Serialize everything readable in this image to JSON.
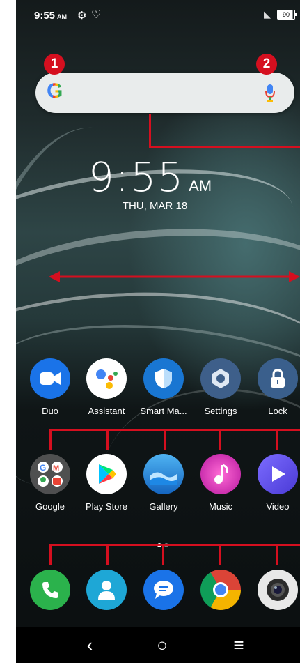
{
  "status_bar": {
    "time": "9:55",
    "ampm": "AM",
    "battery": "90"
  },
  "search": {
    "callout_left": "1",
    "callout_right": "2"
  },
  "clock": {
    "time": "9:55",
    "ampm": "AM",
    "date": "THU, MAR 18"
  },
  "apps_row1": [
    {
      "label": "Duo",
      "icon": "duo-icon"
    },
    {
      "label": "Assistant",
      "icon": "assistant-icon"
    },
    {
      "label": "Smart Ma...",
      "icon": "smart-manager-icon"
    },
    {
      "label": "Settings",
      "icon": "settings-icon"
    },
    {
      "label": "Lock",
      "icon": "lock-icon"
    }
  ],
  "apps_row2": [
    {
      "label": "Google",
      "icon": "google-folder-icon"
    },
    {
      "label": "Play Store",
      "icon": "play-store-icon"
    },
    {
      "label": "Gallery",
      "icon": "gallery-icon"
    },
    {
      "label": "Music",
      "icon": "music-icon"
    },
    {
      "label": "Video",
      "icon": "video-icon"
    }
  ],
  "dock": [
    {
      "icon": "phone-icon"
    },
    {
      "icon": "contacts-icon"
    },
    {
      "icon": "messages-icon"
    },
    {
      "icon": "chrome-icon"
    },
    {
      "icon": "camera-icon"
    }
  ],
  "nav": {
    "back": "‹",
    "home": "○",
    "menu": "≡"
  },
  "colors": {
    "callout_red": "#d50f1f"
  }
}
